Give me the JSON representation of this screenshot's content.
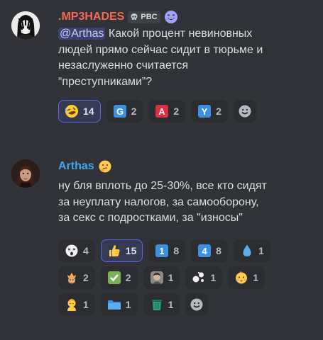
{
  "messages": [
    {
      "username": ".MP3HADES",
      "username_color": "#f96854",
      "tag": "PBC",
      "mention": "@Arthas",
      "lines": [
        " Какой процент невиновных",
        "людей прямо сейчас сидит в тюрьме и",
        "незаслуженно считается",
        "“преступниками”?"
      ],
      "reactions": [
        {
          "icon": "rofl-emoji-icon",
          "count": "14",
          "me": true
        },
        {
          "icon": "regional-g-icon",
          "count": "2"
        },
        {
          "icon": "regional-a-icon",
          "count": "2"
        },
        {
          "icon": "regional-y-icon",
          "count": "2"
        }
      ]
    },
    {
      "username": "Arthas",
      "username_color": "#3ea8f4",
      "lines": [
        "ну бля вплоть до 25-30%, все кто сидят",
        "за неуплату налогов, за самооборону,",
        "за секс с подростками, за \"износы\""
      ],
      "reactions": [
        {
          "icon": "dizzy-face-emoji-icon",
          "count": "4"
        },
        {
          "icon": "thumbs-up-icon",
          "count": "15",
          "me": true
        },
        {
          "icon": "keycap-1-icon",
          "count": "8"
        },
        {
          "icon": "keycap-4-icon",
          "count": "8"
        },
        {
          "icon": "droplet-icon",
          "count": "1"
        },
        {
          "icon": "king-emoji-icon",
          "count": "2"
        },
        {
          "icon": "check-mark-button-icon",
          "count": "2"
        },
        {
          "icon": "person-face-emoji-icon",
          "count": "1"
        },
        {
          "icon": "splash-emoji-icon",
          "count": "1"
        },
        {
          "icon": "baby-face-icon",
          "count": "1"
        },
        {
          "icon": "baby-icon",
          "count": "1"
        },
        {
          "icon": "folder-icon",
          "count": "1"
        },
        {
          "icon": "trash-can-icon",
          "count": "1"
        }
      ]
    }
  ],
  "colors": {
    "background": "#313338",
    "reaction_bg": "#2b2d31",
    "reaction_active_bg": "#373a53",
    "reaction_active_border": "#5865f2",
    "mention_text": "#c9cdfb"
  }
}
